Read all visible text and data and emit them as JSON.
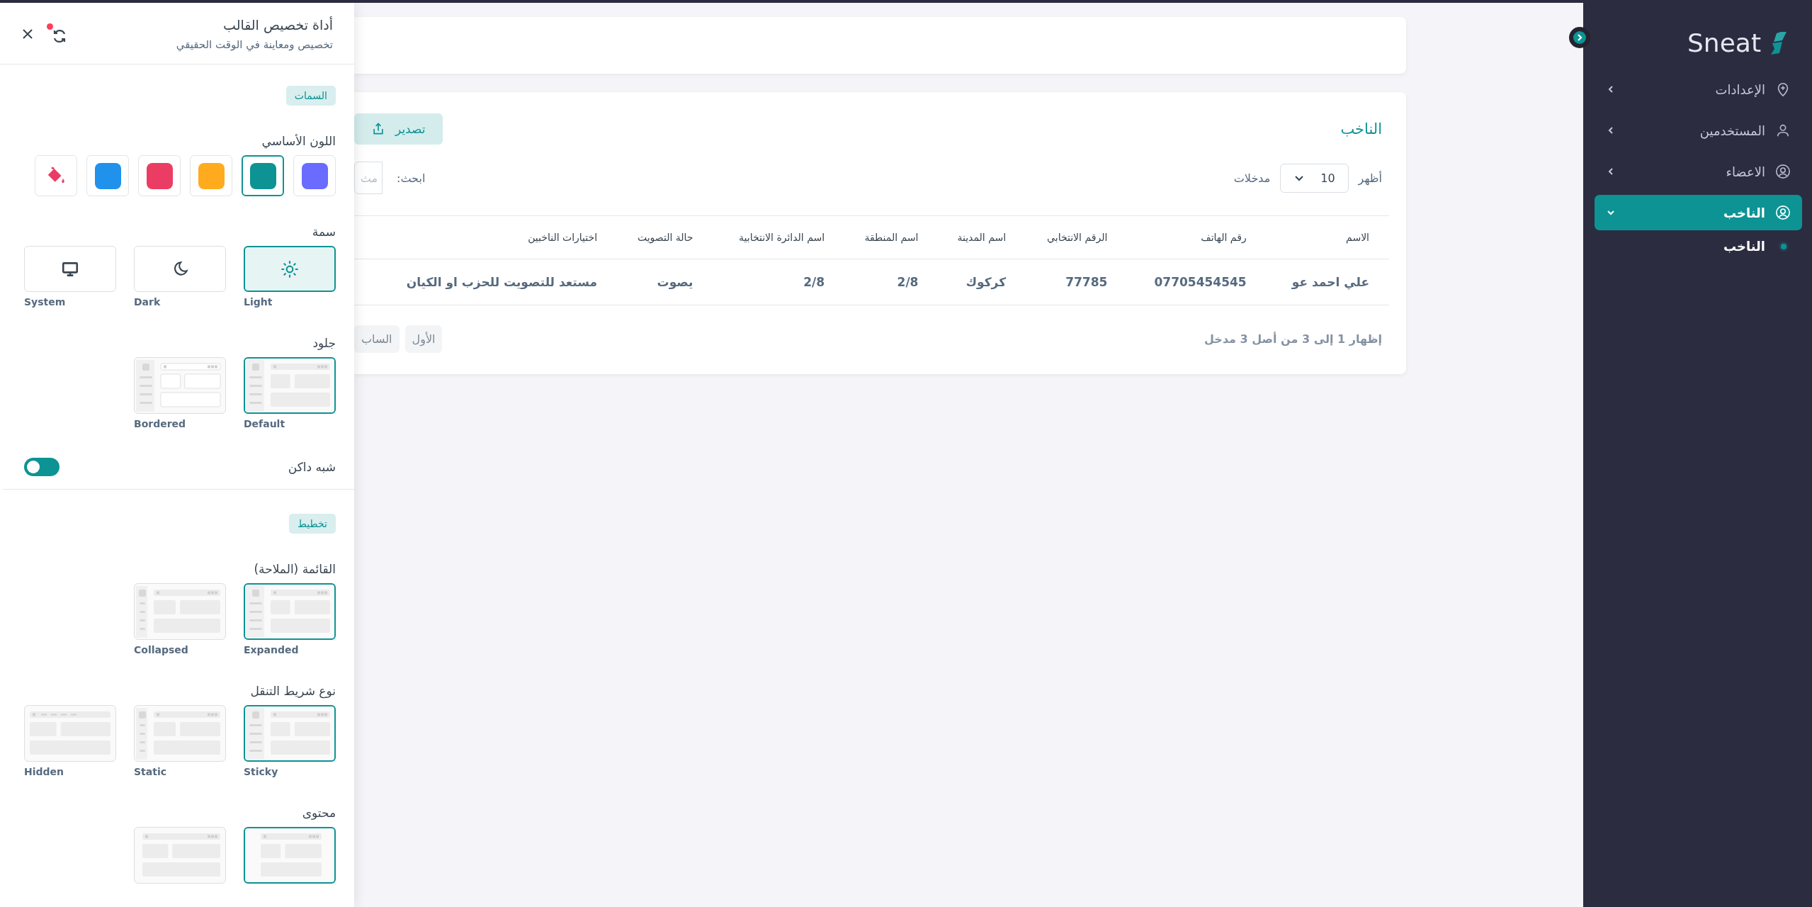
{
  "customizer": {
    "title": "أداة تخصيص القالب",
    "subtitle": "تخصيص ومعاينة في الوقت الحقيقي",
    "sections": [
      {
        "badge": "السمات",
        "groups": [
          {
            "kind": "colors",
            "label": "اللون الأساسي",
            "options": [
              {
                "kind": "swatch",
                "color": "#696cff",
                "selected": false
              },
              {
                "kind": "swatch",
                "color": "#0d9394",
                "selected": true
              },
              {
                "kind": "swatch",
                "color": "#ffab1d",
                "selected": false
              },
              {
                "kind": "swatch",
                "color": "#eb3d63",
                "selected": false
              },
              {
                "kind": "swatch",
                "color": "#2092ec",
                "selected": false
              },
              {
                "kind": "picker",
                "selected": false
              }
            ]
          },
          {
            "kind": "modes",
            "label": "سمة",
            "options": [
              {
                "kind": "light",
                "label": "Light",
                "selected": true
              },
              {
                "kind": "dark",
                "label": "Dark",
                "selected": false
              },
              {
                "kind": "system",
                "label": "System",
                "selected": false
              }
            ]
          },
          {
            "kind": "previews",
            "label": "جلود",
            "options": [
              {
                "kind": "default",
                "label": "Default",
                "selected": true
              },
              {
                "kind": "bordered",
                "label": "Bordered",
                "selected": false
              }
            ]
          },
          {
            "kind": "switch",
            "label": "شبه داكن",
            "on": true
          }
        ]
      },
      {
        "badge": "تخطيط",
        "groups": [
          {
            "kind": "previews",
            "label": "القائمة (الملاحة)",
            "options": [
              {
                "kind": "default",
                "label": "Expanded",
                "selected": true
              },
              {
                "kind": "collapsed",
                "label": "Collapsed",
                "selected": false
              }
            ]
          },
          {
            "kind": "previews",
            "label": "نوع شريط التنقل",
            "options": [
              {
                "kind": "default",
                "label": "Sticky",
                "selected": true
              },
              {
                "kind": "collapsed",
                "label": "Static",
                "selected": false
              },
              {
                "kind": "hidden",
                "label": "Hidden",
                "selected": false
              }
            ]
          },
          {
            "kind": "previews",
            "label": "محتوى",
            "options": [
              {
                "kind": "compact",
                "selected": true
              },
              {
                "kind": "wide",
                "selected": false
              }
            ]
          }
        ]
      }
    ]
  },
  "main": {
    "card": {
      "title": "الناخب",
      "export_button": "تصدير",
      "show_label": "أظهر",
      "page_size": "10",
      "entries_label": "مدخلات",
      "search_label": "ابحث:",
      "search": {
        "placeholder": "مث"
      },
      "table": {
        "columns": [
          "الاسم",
          "رقم الهاتف",
          "الرقم الانتخابي",
          "اسم المدينة",
          "اسم المنطقة",
          "اسم الدائرة الانتخابية",
          "حالة التصويت",
          "اختيارات الناخبين"
        ],
        "rows": [
          [
            "علي احمد عو",
            "07705454545",
            "77785",
            "كركوك",
            "2/8",
            "2/8",
            "يصوت",
            "مستعد للتصويت للحزب او الكيان"
          ]
        ]
      },
      "info": "إظهار 1 إلى 3 من أصل 3 مدخل",
      "pagination": [
        {
          "label": "الأول",
          "disabled": true
        },
        {
          "label": "الساب",
          "disabled": true
        }
      ]
    }
  },
  "sidebar": {
    "logo": "Sneat",
    "items": [
      {
        "kind": "pin",
        "label": "الإعدادات",
        "selected": false,
        "expanded": false
      },
      {
        "kind": "user",
        "label": "المستخدمين",
        "selected": false,
        "expanded": false
      },
      {
        "kind": "user-circle",
        "label": "الاعضاء",
        "selected": false,
        "expanded": false
      },
      {
        "kind": "user-circle",
        "label": "الناخب",
        "selected": true,
        "expanded": true,
        "children": [
          {
            "label": "الناخب",
            "selected": true
          }
        ]
      }
    ]
  }
}
